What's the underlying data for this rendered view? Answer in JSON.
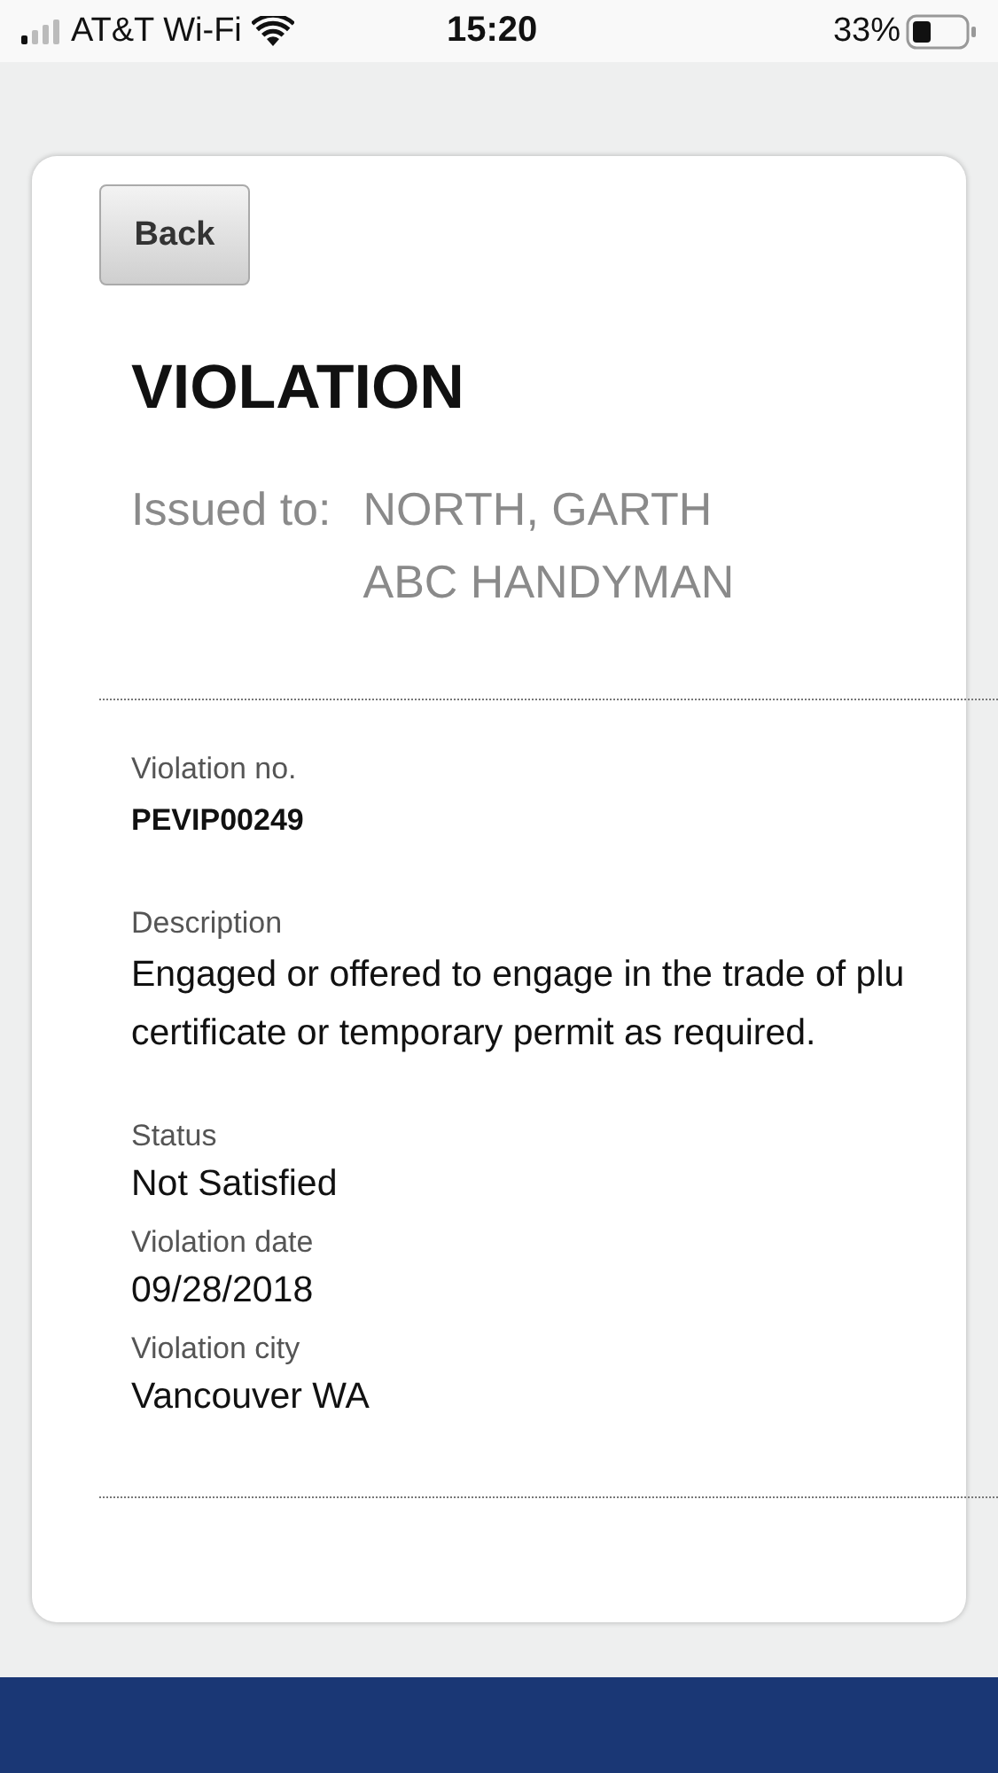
{
  "status_bar": {
    "carrier": "AT&T Wi-Fi",
    "time": "15:20",
    "battery": "33%"
  },
  "back_button": "Back",
  "title": "VIOLATION",
  "issued_to": {
    "label": "Issued to:",
    "lines": [
      "NORTH, GARTH",
      "ABC HANDYMAN"
    ]
  },
  "violation_no": {
    "label": "Violation no.",
    "value": "PEVIP00249"
  },
  "description": {
    "label": "Description",
    "lines": [
      "Engaged or offered to engage in the trade of plu",
      "certificate or temporary permit as required."
    ]
  },
  "fields": [
    {
      "label": "Status",
      "value": "Not Satisfied"
    },
    {
      "label": "Violation date",
      "value": "09/28/2018"
    },
    {
      "label": "Violation city",
      "value": "Vancouver WA"
    }
  ]
}
